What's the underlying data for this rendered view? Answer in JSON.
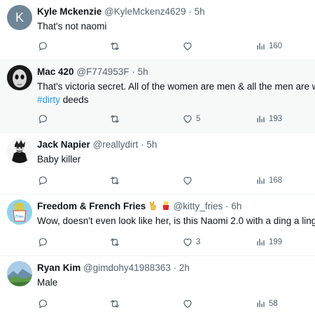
{
  "colors": {
    "link": "#1d9bf0",
    "muted": "#536471",
    "text": "#0f1419",
    "divider": "#eff3f4"
  },
  "tweets": [
    {
      "name": "Kyle Mckenzie",
      "handle": "@KyleMckenz4629",
      "sep": "·",
      "time": "5h",
      "text": "That's not naomi",
      "text2": "",
      "hashtag": "",
      "hashtag_suffix": "",
      "avatar": {
        "type": "initial",
        "letter": "K",
        "color": "#6e8595"
      },
      "reply": "",
      "retweet": "",
      "like": "",
      "views": "160"
    },
    {
      "name": "Mac 420",
      "handle": "@F774953F",
      "sep": "·",
      "time": "5h",
      "text": "That's victoria secret. All of the women are men & all the men are w",
      "text2": "",
      "hashtag": "#dirty",
      "hashtag_suffix": " deeds",
      "avatar": {
        "type": "mask-icon"
      },
      "reply": "",
      "retweet": "",
      "like": "5",
      "views": "193"
    },
    {
      "name": "Jack Napier",
      "handle": "@reallydirt",
      "sep": "·",
      "time": "5h",
      "text": "Baby killer",
      "text2": "",
      "hashtag": "",
      "hashtag_suffix": "",
      "avatar": {
        "type": "joker-icon"
      },
      "reply": "",
      "retweet": "",
      "like": "",
      "views": "168"
    },
    {
      "name": "Freedom & French Fries",
      "emoji": [
        "victory-hand-icon",
        "fries-icon"
      ],
      "handle": "@kitty_fries",
      "sep": "·",
      "time": "6h",
      "text": "Wow, doesn't even look like her, is this Naomi 2.0 with a ding a ling",
      "text2": "",
      "hashtag": "",
      "hashtag_suffix": "",
      "avatar": {
        "type": "fries-icon",
        "label": "Fries"
      },
      "reply": "",
      "retweet": "",
      "like": "3",
      "views": "199"
    },
    {
      "name": "Ryan Kim",
      "handle": "@gimdohy41988363",
      "sep": "·",
      "time": "2h",
      "text": "Male",
      "text2": "",
      "hashtag": "",
      "hashtag_suffix": "",
      "avatar": {
        "type": "landscape-icon"
      },
      "reply": "",
      "retweet": "",
      "like": "",
      "views": "58"
    }
  ]
}
